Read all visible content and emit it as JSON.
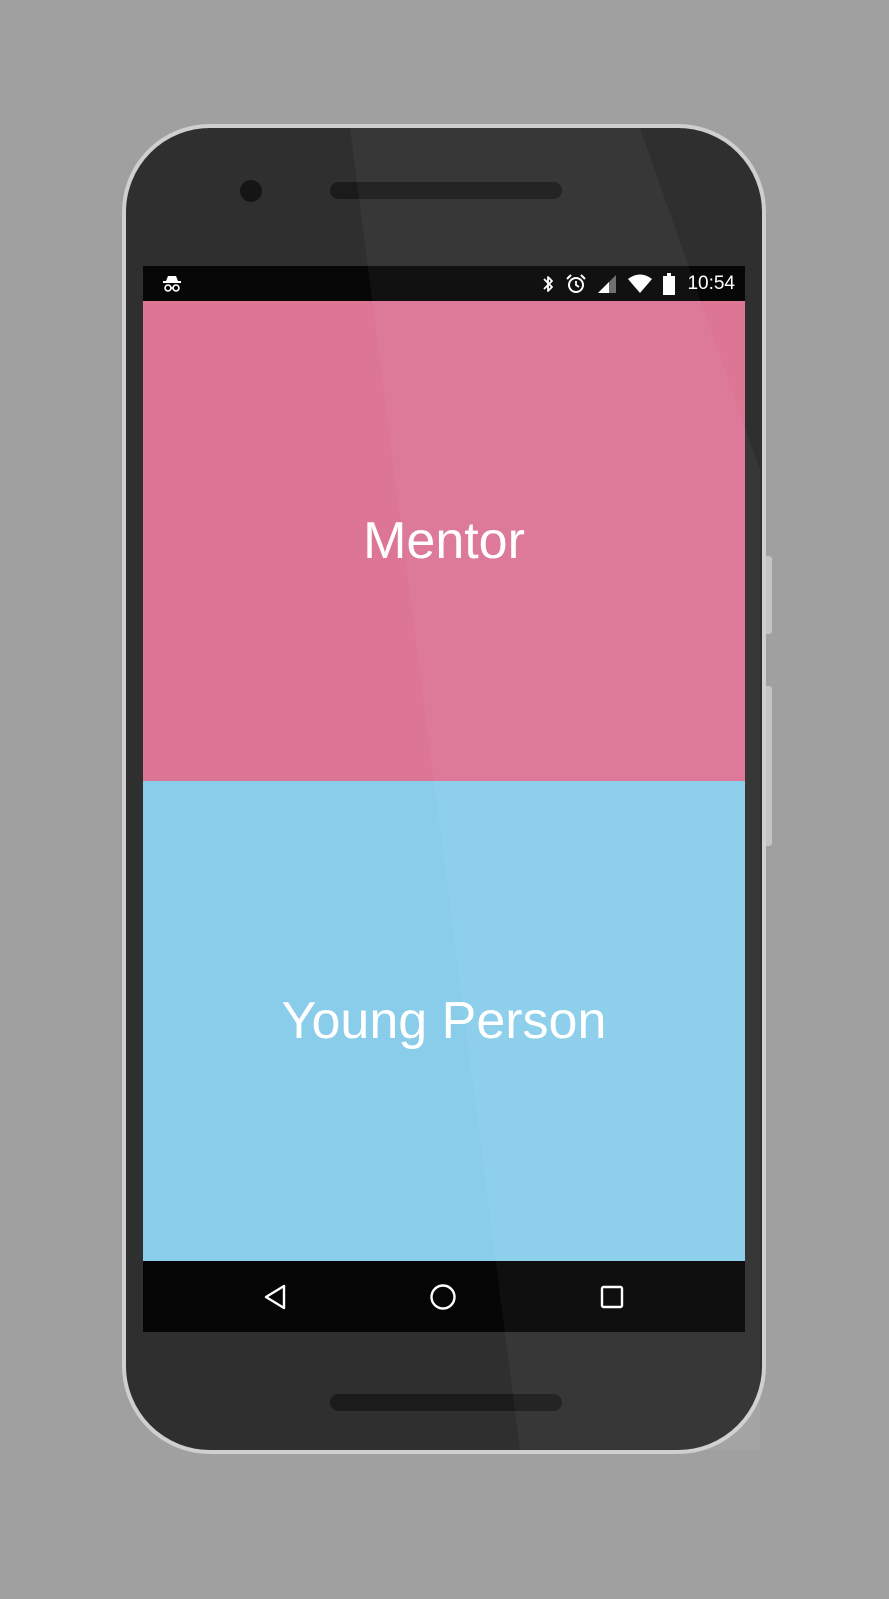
{
  "status_bar": {
    "time": "10:54",
    "left_icon": "incognito-icon",
    "right_icons": [
      "bluetooth-icon",
      "alarm-icon",
      "cell-signal-icon",
      "wifi-icon",
      "battery-icon"
    ]
  },
  "role_selection": {
    "mentor_label": "Mentor",
    "young_person_label": "Young Person"
  },
  "colors": {
    "mentor": "#dd7595",
    "young_person": "#89cdeb",
    "background": "#a0a0a0"
  },
  "nav_bar": {
    "buttons": [
      "back-icon",
      "home-icon",
      "recents-icon"
    ]
  }
}
